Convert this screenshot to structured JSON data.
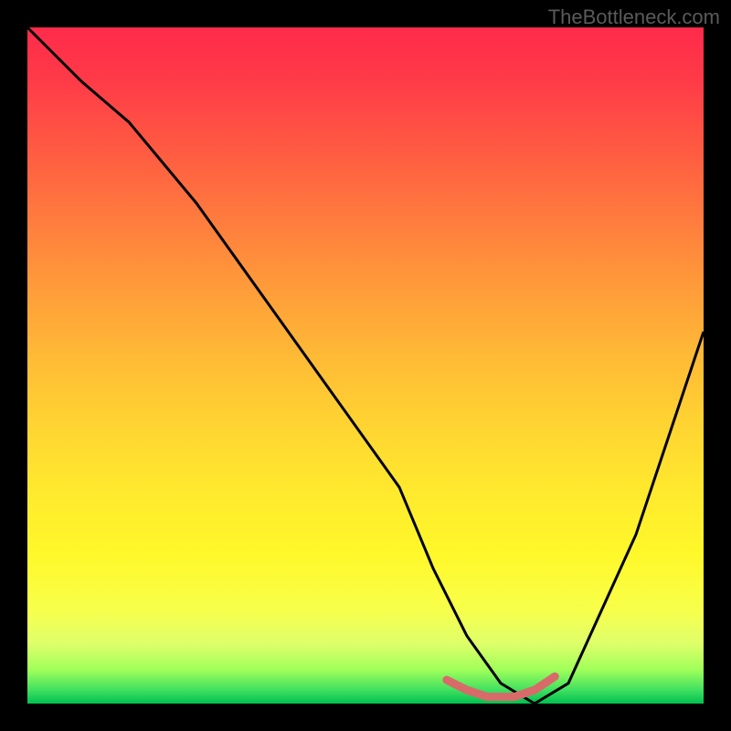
{
  "watermark": "TheBottleneck.com",
  "chart_data": {
    "type": "line",
    "title": "",
    "xlabel": "",
    "ylabel": "",
    "xlim": [
      0,
      100
    ],
    "ylim": [
      0,
      100
    ],
    "series": [
      {
        "name": "bottleneck-curve",
        "x": [
          0,
          8,
          15,
          25,
          35,
          45,
          55,
          60,
          65,
          70,
          75,
          80,
          90,
          100
        ],
        "y": [
          100,
          92,
          86,
          74,
          60,
          46,
          32,
          20,
          10,
          3,
          0,
          3,
          25,
          55
        ]
      }
    ],
    "highlight_segment": {
      "name": "optimal-range",
      "x": [
        62,
        65,
        68,
        72,
        75,
        78
      ],
      "y": [
        3.5,
        2,
        1,
        1,
        2,
        4
      ]
    },
    "gradient_stops": [
      {
        "pos": 0,
        "color": "#ff2a4a"
      },
      {
        "pos": 50,
        "color": "#ffd232"
      },
      {
        "pos": 85,
        "color": "#fff82a"
      },
      {
        "pos": 100,
        "color": "#00c050"
      }
    ]
  }
}
